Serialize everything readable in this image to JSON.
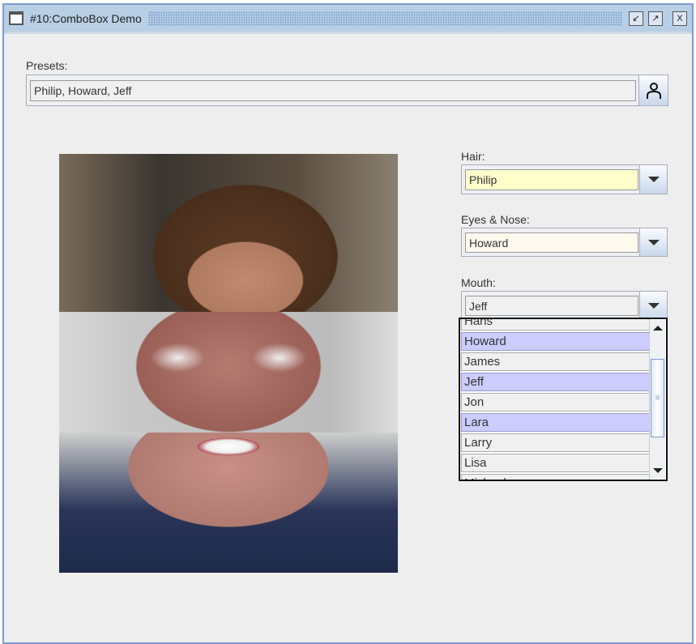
{
  "window": {
    "title": "#10:ComboBox Demo",
    "buttons": [
      "iconify",
      "maximize",
      "close"
    ]
  },
  "presets": {
    "label": "Presets:",
    "value": "Philip, Howard, Jeff",
    "button_icon": "person-icon"
  },
  "hair": {
    "label": "Hair:",
    "value": "Philip",
    "bg": "#ffffcc"
  },
  "eyes": {
    "label": "Eyes & Nose:",
    "value": "Howard",
    "bg": "#fdf9ee"
  },
  "mouth": {
    "label": "Mouth:",
    "value": "Jeff"
  },
  "list": {
    "items": [
      {
        "label": "Hans",
        "selected": false
      },
      {
        "label": "Howard",
        "selected": true
      },
      {
        "label": "James",
        "selected": false
      },
      {
        "label": "Jeff",
        "selected": true
      },
      {
        "label": "Jon",
        "selected": false
      },
      {
        "label": "Lara",
        "selected": true
      },
      {
        "label": "Larry",
        "selected": false
      },
      {
        "label": "Lisa",
        "selected": false
      },
      {
        "label": "Michael",
        "selected": false
      }
    ]
  },
  "colors": {
    "selection": "#ccccff",
    "titlebar": "#b8cfe5"
  }
}
